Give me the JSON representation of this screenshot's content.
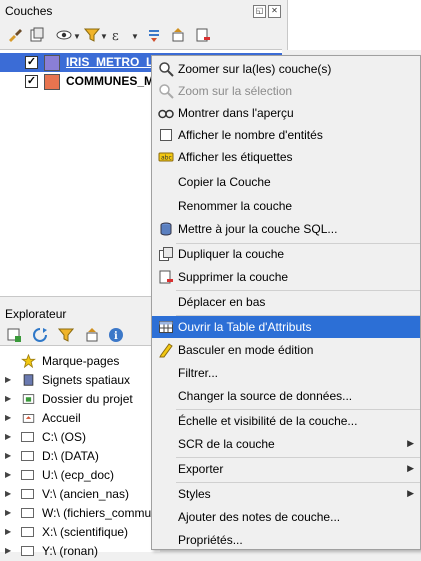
{
  "layers_panel": {
    "title": "Couches",
    "dock_buttons": [
      "◱",
      "✕"
    ],
    "layers": [
      {
        "name": "IRIS_METRO_LI",
        "checked": "✓",
        "color": "#8a7fd6",
        "selected": true
      },
      {
        "name": "COMMUNES_M",
        "checked": "✓",
        "color": "#e8744f",
        "selected": false
      }
    ]
  },
  "explorer": {
    "title": "Explorateur",
    "items": [
      {
        "label": "Marque-pages",
        "icon": "star-icon",
        "expander": ""
      },
      {
        "label": "Signets spatiaux",
        "icon": "bookmarks-icon",
        "expander": "▶"
      },
      {
        "label": "Dossier du projet",
        "icon": "project-folder-icon",
        "expander": "▶"
      },
      {
        "label": "Accueil",
        "icon": "home-folder-icon",
        "expander": "▶"
      },
      {
        "label": "C:\\ (OS)",
        "icon": "folder-icon",
        "expander": "▶"
      },
      {
        "label": "D:\\ (DATA)",
        "icon": "folder-icon",
        "expander": "▶"
      },
      {
        "label": "U:\\ (ecp_doc)",
        "icon": "folder-icon",
        "expander": "▶"
      },
      {
        "label": "V:\\ (ancien_nas)",
        "icon": "folder-icon",
        "expander": "▶"
      },
      {
        "label": "W:\\ (fichiers_commu",
        "icon": "folder-icon",
        "expander": "▶"
      },
      {
        "label": "X:\\ (scientifique)",
        "icon": "folder-icon",
        "expander": "▶"
      },
      {
        "label": "Y:\\ (ronan)",
        "icon": "folder-icon",
        "expander": "▶"
      }
    ]
  },
  "context_menu": {
    "items": [
      {
        "label": "Zoomer sur la(les) couche(s)",
        "icon": "zoom-layer-icon",
        "disabled": false,
        "submenu": false
      },
      {
        "label": "Zoom sur la sélection",
        "icon": "zoom-selection-icon",
        "disabled": true,
        "submenu": false
      },
      {
        "label": "Montrer dans l'aperçu",
        "icon": "overview-icon",
        "disabled": false,
        "submenu": false
      },
      {
        "label": "Afficher le nombre d'entités",
        "icon": "checkbox-icon",
        "disabled": false,
        "submenu": false
      },
      {
        "label": "Afficher les étiquettes",
        "icon": "labels-icon",
        "disabled": false,
        "submenu": false
      },
      {
        "label": "Copier la Couche",
        "icon": "",
        "disabled": false,
        "submenu": false
      },
      {
        "label": "Renommer la couche",
        "icon": "",
        "disabled": false,
        "submenu": false
      },
      {
        "label": "Mettre à jour la couche SQL...",
        "icon": "database-icon",
        "disabled": false,
        "submenu": false
      },
      {
        "label": "Dupliquer la couche",
        "icon": "duplicate-icon",
        "disabled": false,
        "submenu": false
      },
      {
        "label": "Supprimer la couche",
        "icon": "remove-layer-icon",
        "disabled": false,
        "submenu": false
      },
      {
        "label": "Déplacer en bas",
        "icon": "",
        "disabled": false,
        "submenu": false
      },
      {
        "label": "Ouvrir la Table d'Attributs",
        "icon": "table-icon",
        "disabled": false,
        "submenu": false,
        "highlighted": true
      },
      {
        "label": "Basculer en mode édition",
        "icon": "pencil-icon",
        "disabled": false,
        "submenu": false
      },
      {
        "label": "Filtrer...",
        "icon": "",
        "disabled": false,
        "submenu": false
      },
      {
        "label": "Changer la source de données...",
        "icon": "",
        "disabled": false,
        "submenu": false
      },
      {
        "label": "Échelle et visibilité de la couche...",
        "icon": "",
        "disabled": false,
        "submenu": false
      },
      {
        "label": "SCR de la couche",
        "icon": "",
        "disabled": false,
        "submenu": true
      },
      {
        "label": "Exporter",
        "icon": "",
        "disabled": false,
        "submenu": true
      },
      {
        "label": "Styles",
        "icon": "",
        "disabled": false,
        "submenu": true
      },
      {
        "label": "Ajouter des notes de couche...",
        "icon": "",
        "disabled": false,
        "submenu": false
      },
      {
        "label": "Propriétés...",
        "icon": "",
        "disabled": false,
        "submenu": false
      }
    ],
    "submenu_arrow": "▶"
  },
  "colors": {
    "selection": "#3b6cd6",
    "menu_highlight": "#2c6fd6"
  }
}
